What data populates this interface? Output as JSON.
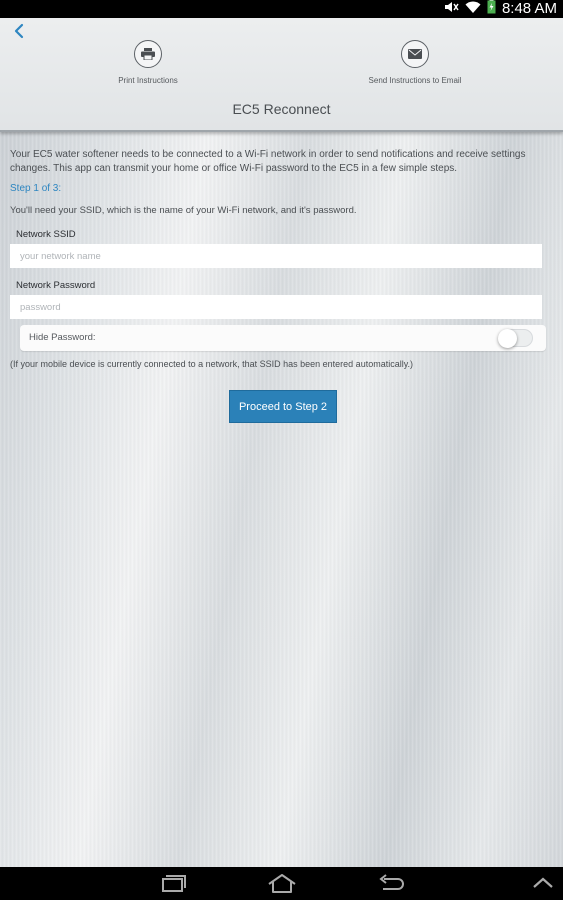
{
  "statusbar": {
    "time": "8:48 AM"
  },
  "header": {
    "title": "EC5 Reconnect",
    "print_label": "Print Instructions",
    "email_label": "Send Instructions to Email"
  },
  "content": {
    "intro": "Your EC5 water softener needs to be connected to a Wi-Fi network in order to send notifications and receive settings changes. This app can transmit your home or office Wi-Fi password to the EC5 in a few simple steps.",
    "step": "Step 1 of 3:",
    "need": "You'll need your SSID, which is the name of your Wi-Fi network, and it's password.",
    "ssid_label": "Network SSID",
    "ssid_placeholder": "your network name",
    "password_label": "Network Password",
    "password_placeholder": "password",
    "hide_label": "Hide Password:",
    "hide_password": false,
    "note": "(If your mobile device is currently connected to a network, that SSID has been entered automatically.)",
    "proceed_label": "Proceed to Step 2"
  },
  "icons": {
    "back": "chevron-left-icon",
    "print": "printer-icon",
    "email": "envelope-icon",
    "recent": "recent-apps-icon",
    "home": "home-icon",
    "nav_back": "back-arrow-icon",
    "up": "chevron-up-icon"
  },
  "colors": {
    "accent": "#2b81b8",
    "step_text": "#2e86c1"
  }
}
